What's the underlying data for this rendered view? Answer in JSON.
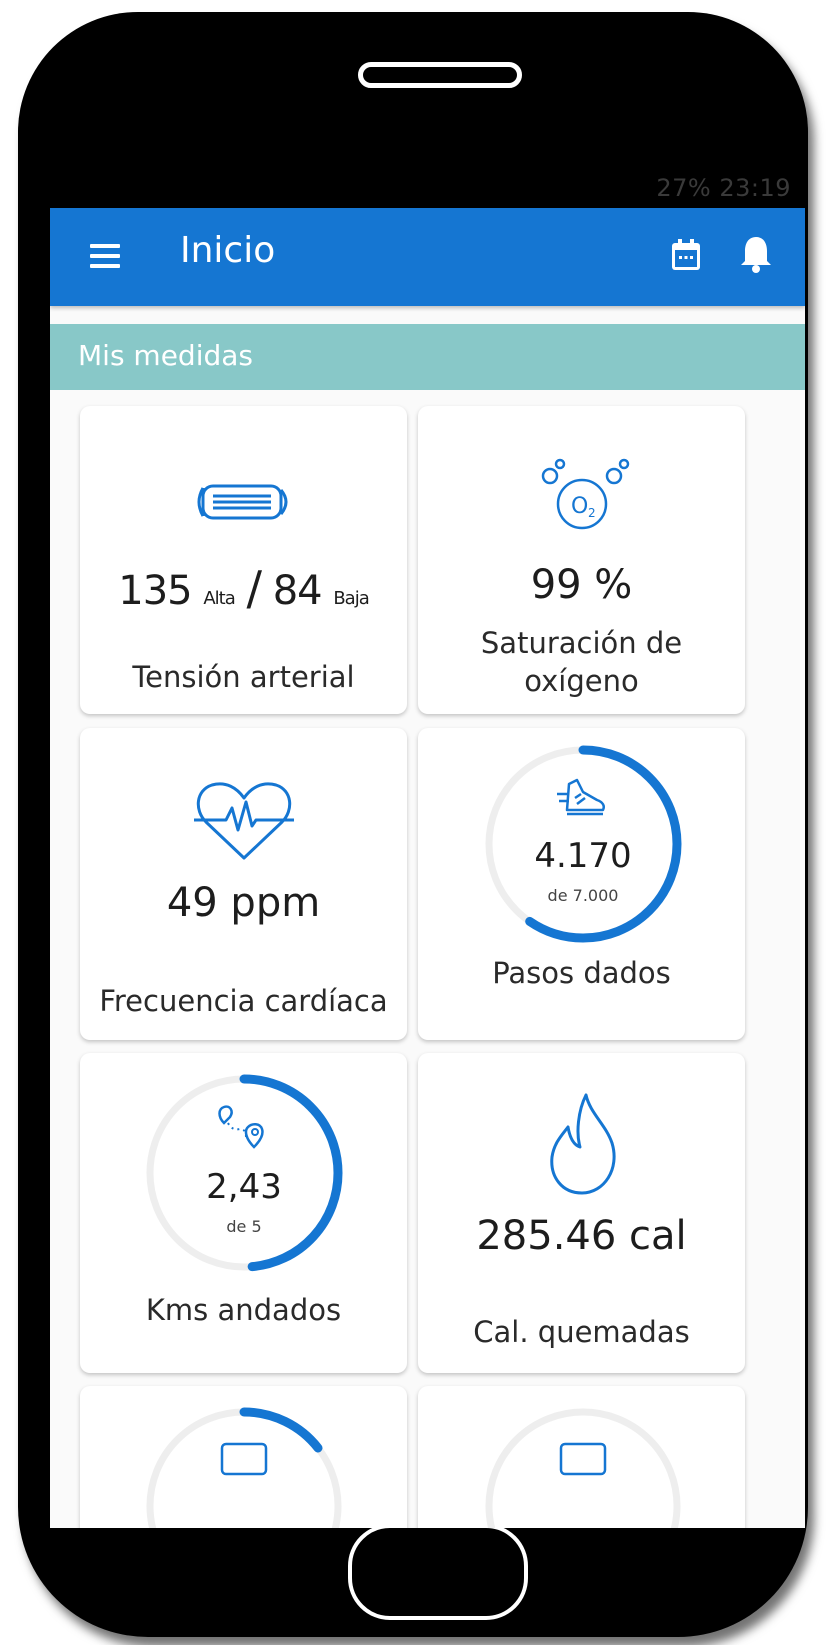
{
  "status_bar": {
    "text": "27% 23:19"
  },
  "app_bar": {
    "title": "Inicio",
    "menu_icon": "menu-icon",
    "calendar_icon": "calendar-icon",
    "bell_icon": "bell-icon"
  },
  "section": {
    "title": "Mis medidas"
  },
  "colors": {
    "primary": "#1576d2",
    "section": "#88c8c8",
    "ring_track": "#eeeeee"
  },
  "cards": {
    "tension": {
      "high": "135",
      "high_unit": "Alta",
      "sep": "/",
      "low": "84",
      "low_unit": "Baja",
      "label": "Tensión arterial",
      "icon": "blood-pressure-cuff-icon"
    },
    "oxygen": {
      "value": "99 %",
      "label_line1": "Saturación de",
      "label_line2": "oxígeno",
      "icon": "oxygen-bubbles-icon"
    },
    "heart": {
      "value": "49 ppm",
      "label": "Frecuencia cardíaca",
      "icon": "heart-pulse-icon"
    },
    "steps": {
      "value": "4.170",
      "goal": "de 7.000",
      "label": "Pasos dados",
      "progress": 0.5957,
      "icon": "running-shoe-icon"
    },
    "kms": {
      "value": "2,43",
      "goal": "de 5",
      "label": "Kms andados",
      "progress": 0.486,
      "icon": "route-pins-icon"
    },
    "calories": {
      "value": "285.46 cal",
      "label": "Cal. quemadas",
      "icon": "flame-icon"
    }
  }
}
